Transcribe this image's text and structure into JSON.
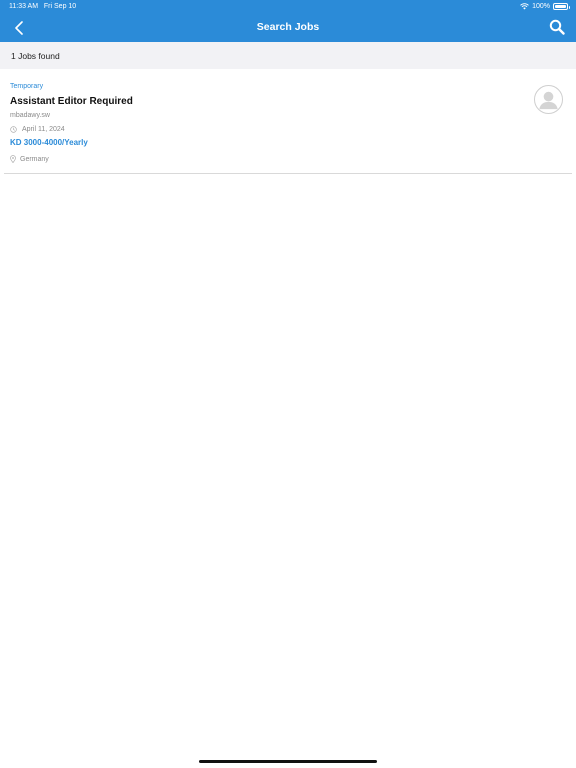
{
  "status_bar": {
    "time": "11:33 AM",
    "date": "Fri Sep 10",
    "battery_percent": "100%",
    "battery_level": 1.0,
    "wifi_icon": "wifi-icon",
    "battery_icon": "battery-icon"
  },
  "nav": {
    "title": "Search Jobs",
    "back_icon": "chevron-left-icon",
    "search_icon": "search-icon"
  },
  "results": {
    "count_text": "1 Jobs found"
  },
  "jobs": [
    {
      "type": "Temporary",
      "title": "Assistant Editor Required",
      "company": "mbadawy.sw",
      "date": "April 11, 2024",
      "salary": "KD 3000-4000/Yearly",
      "location": "Germany",
      "avatar_icon": "avatar-placeholder-icon"
    }
  ],
  "colors": {
    "primary": "#2b8bd8",
    "muted_text": "#8a8a8a",
    "results_bar": "#f2f2f5"
  }
}
